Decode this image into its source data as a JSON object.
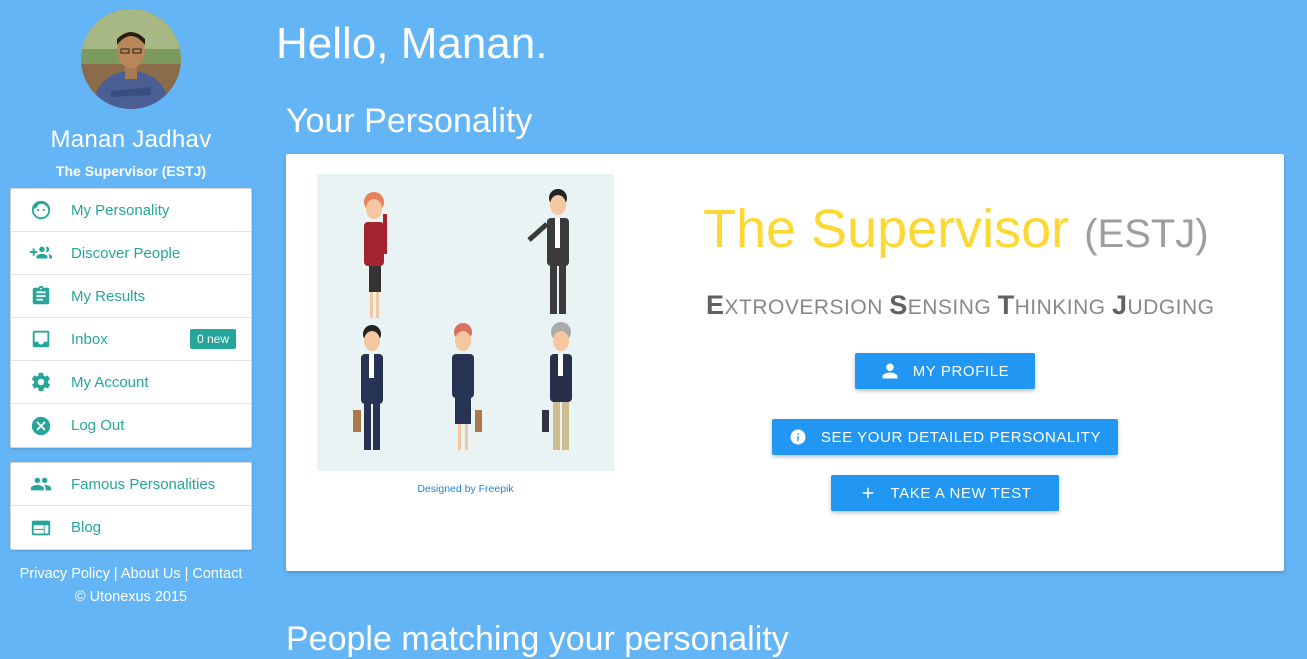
{
  "user": {
    "name": "Manan Jadhav",
    "type": "The Supervisor (ESTJ)"
  },
  "menu": [
    {
      "label": "My Personality",
      "icon": "face-icon"
    },
    {
      "label": "Discover People",
      "icon": "group-add-icon"
    },
    {
      "label": "My Results",
      "icon": "clipboard-icon"
    },
    {
      "label": "Inbox",
      "icon": "inbox-icon",
      "badge": "0 new"
    },
    {
      "label": "My Account",
      "icon": "gear-icon"
    },
    {
      "label": "Log Out",
      "icon": "cancel-icon"
    }
  ],
  "menu2": [
    {
      "label": "Famous Personalities",
      "icon": "people-icon"
    },
    {
      "label": "Blog",
      "icon": "web-icon"
    }
  ],
  "footer": {
    "privacy": "Privacy Policy",
    "sep1": " | ",
    "about": "About Us",
    "sep2": " | ",
    "contact": "Contact",
    "copyright": "© Utonexus 2015"
  },
  "main": {
    "greeting": "Hello, Manan.",
    "section_title": "Your Personality",
    "section_title2": "People matching your personality",
    "credit": "Designed by Freepik",
    "type_name": "The Supervisor",
    "type_code": "(ESTJ)",
    "dimensions": [
      {
        "initial": "E",
        "rest": "XTROVERSION"
      },
      {
        "initial": "S",
        "rest": "ENSING"
      },
      {
        "initial": "T",
        "rest": "HINKING"
      },
      {
        "initial": "J",
        "rest": "UDGING"
      }
    ],
    "buttons": {
      "profile": "MY PROFILE",
      "detailed": "SEE YOUR DETAILED PERSONALITY",
      "new_test": "TAKE A NEW TEST"
    }
  },
  "colors": {
    "background": "#64b5f6",
    "accent_teal": "#26a69a",
    "button_blue": "#2196f3",
    "title_yellow": "#fdd835"
  }
}
